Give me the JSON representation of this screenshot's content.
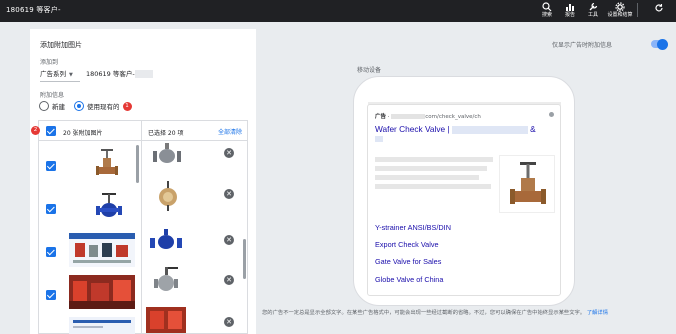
{
  "topbar": {
    "account_title": "180619 等客户-",
    "items": [
      {
        "label": "搜索",
        "icon": "search-icon"
      },
      {
        "label": "报告",
        "icon": "report-icon"
      },
      {
        "label": "工具",
        "icon": "tools-icon"
      },
      {
        "label": "设置和结算",
        "icon": "settings-icon"
      }
    ],
    "refresh_icon": "refresh-icon"
  },
  "editor": {
    "title": "添加附加图片",
    "add_to_label": "添加到",
    "level_value": "广告系列",
    "account_value": "180619 等客户-",
    "extension_label": "附加信息",
    "radio_new": "新建",
    "radio_existing": "使用现有的",
    "badge_1": "1",
    "badge_2": "2",
    "available_header": "20 张附加图片",
    "selected_header": "已选择 20 项",
    "clear_all": "全部清除",
    "remove_glyph": "✕"
  },
  "preview": {
    "toggle_label": "仅显示广告时附加信息",
    "toggle_on": true,
    "device_label": "移动设备",
    "ad_label": "广告",
    "ad_url": "com/check_valve/ch",
    "headline": "Wafer Check Valve |",
    "headline_suffix": "&",
    "sitelinks": [
      "Y-strainer ANSI/BS/DIN",
      "Export Check Valve",
      "Gate Valve for Sales",
      "Globe Valve of China"
    ]
  },
  "footer": {
    "note": "您的广告不一定总是显示全部文字。在某些广告格式中，可能会出现一些经过截断的省略。不过，您可以确保在广告中始终显示某些文字。",
    "link": "了解详情"
  },
  "colors": {
    "accent": "#1a73e8",
    "topbar": "#202124",
    "link": "#1a0dab",
    "badge": "#e53935"
  }
}
